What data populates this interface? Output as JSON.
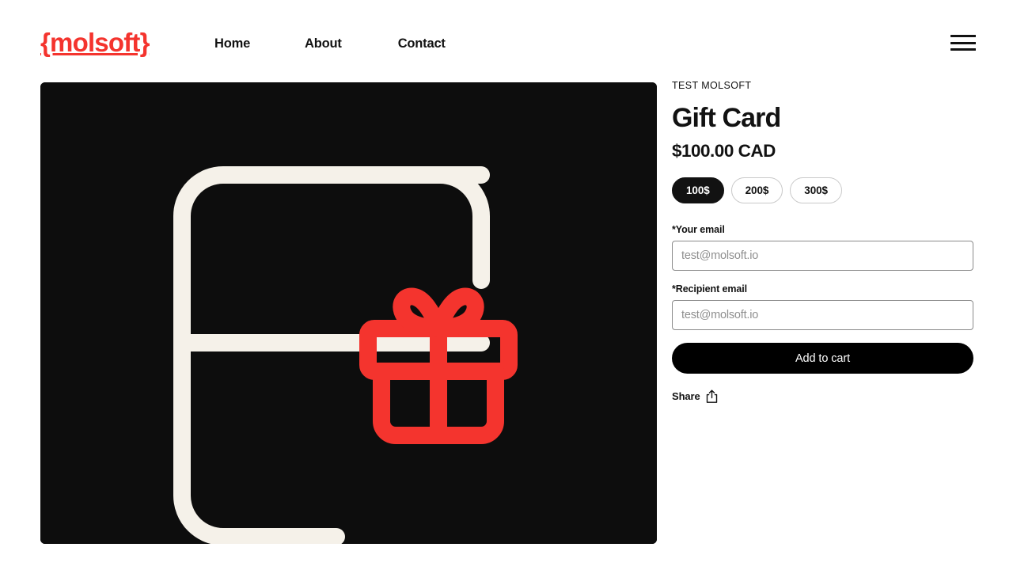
{
  "header": {
    "logo_text": "{molsoft}",
    "logo_color": "#F4342E",
    "nav": [
      {
        "label": "Home"
      },
      {
        "label": "About"
      },
      {
        "label": "Contact"
      }
    ],
    "menu_icon": "hamburger-menu-icon"
  },
  "gallery": {
    "background_color": "#0d0d0d",
    "card_stroke_color": "#F5F1E9",
    "gift_color": "#F4342E",
    "icons": [
      "gift-card-icon",
      "gift-box-icon"
    ]
  },
  "product": {
    "vendor": "TEST MOLSOFT",
    "title": "Gift Card",
    "price": "$100.00 CAD",
    "variant_options": [
      {
        "label": "100$",
        "selected": true
      },
      {
        "label": "200$",
        "selected": false
      },
      {
        "label": "300$",
        "selected": false
      }
    ],
    "fields": [
      {
        "label": "*Your email",
        "value": "",
        "placeholder": "test@molsoft.io"
      },
      {
        "label": "*Recipient email",
        "value": "",
        "placeholder": "test@molsoft.io"
      }
    ],
    "add_to_cart_label": "Add to cart",
    "share_label": "Share",
    "share_icon": "share-icon"
  }
}
